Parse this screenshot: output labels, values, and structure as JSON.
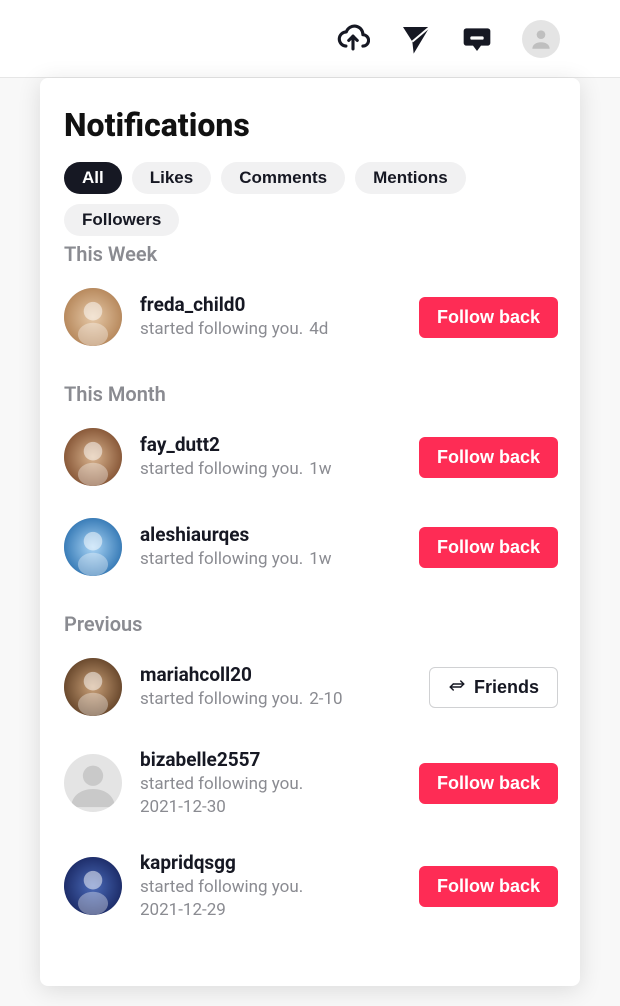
{
  "header": {
    "icons": [
      "upload-icon",
      "send-icon",
      "inbox-icon",
      "profile-avatar"
    ]
  },
  "panel": {
    "title": "Notifications",
    "filters": [
      {
        "label": "All",
        "active": true
      },
      {
        "label": "Likes",
        "active": false
      },
      {
        "label": "Comments",
        "active": false
      },
      {
        "label": "Mentions",
        "active": false
      },
      {
        "label": "Followers",
        "active": false
      }
    ],
    "follow_back_label": "Follow back",
    "friends_label": "Friends",
    "sections": [
      {
        "label": "This Week",
        "items": [
          {
            "username": "freda_child0",
            "message": "started following you.",
            "time": "4d",
            "action": "follow",
            "avatar": "photo1"
          }
        ]
      },
      {
        "label": "This Month",
        "items": [
          {
            "username": "fay_dutt2",
            "message": "started following you.",
            "time": "1w",
            "action": "follow",
            "avatar": "photo2"
          },
          {
            "username": "aleshiaurqes",
            "message": "started following you.",
            "time": "1w",
            "action": "follow",
            "avatar": "photo3"
          }
        ]
      },
      {
        "label": "Previous",
        "items": [
          {
            "username": "mariahcoll20",
            "message": "started following you.",
            "time": "2-10",
            "action": "friends",
            "avatar": "photo4"
          },
          {
            "username": "bizabelle2557",
            "message": "started following you.",
            "time": "2021-12-30",
            "action": "follow",
            "avatar": "blank",
            "wrap": true
          },
          {
            "username": "kapridqsgg",
            "message": "started following you.",
            "time": "2021-12-29",
            "action": "follow",
            "avatar": "photo5",
            "wrap": true
          }
        ]
      }
    ]
  }
}
